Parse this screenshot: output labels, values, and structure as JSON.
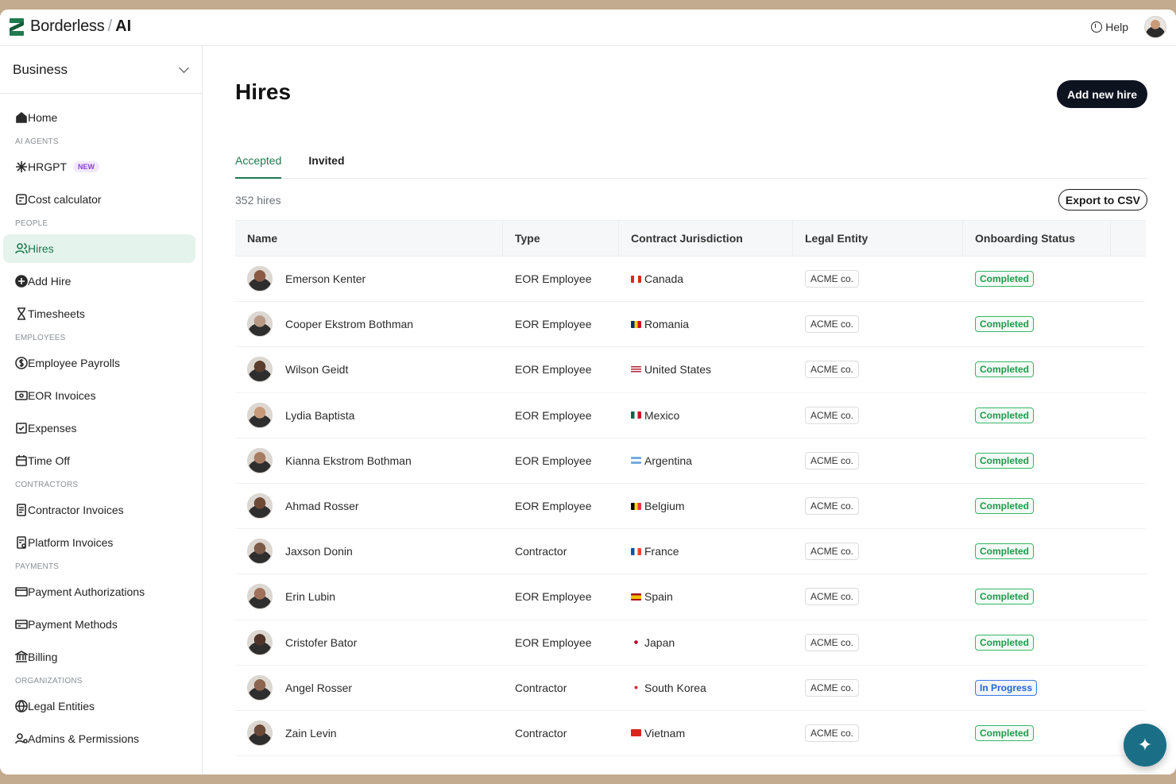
{
  "brand": {
    "name": "Borderless",
    "separator": "/",
    "suffix": "AI"
  },
  "header": {
    "help_label": "Help"
  },
  "sidebar": {
    "workspace": "Business",
    "home": "Home",
    "sections": {
      "ai_agents": "AI AGENTS",
      "people": "PEOPLE",
      "employees": "EMPLOYEES",
      "contractors": "CONTRACTORS",
      "payments": "PAYMENTS",
      "organizations": "ORGANIZATIONS"
    },
    "items": {
      "hrgpt": "HRGPT",
      "hrgpt_badge": "NEW",
      "cost_calculator": "Cost calculator",
      "hires": "Hires",
      "add_hire": "Add Hire",
      "timesheets": "Timesheets",
      "employee_payrolls": "Employee Payrolls",
      "eor_invoices": "EOR Invoices",
      "expenses": "Expenses",
      "time_off": "Time Off",
      "contractor_invoices": "Contractor Invoices",
      "platform_invoices": "Platform Invoices",
      "payment_authorizations": "Payment Authorizations",
      "payment_methods": "Payment Methods",
      "billing": "Billing",
      "legal_entities": "Legal Entities",
      "admins_permissions": "Admins & Permissions"
    }
  },
  "main": {
    "title": "Hires",
    "add_button": "Add new hire",
    "tabs": [
      "Accepted",
      "Invited"
    ],
    "count": "352 hires",
    "export_button": "Export to CSV",
    "columns": [
      "Name",
      "Type",
      "Contract Jurisdiction",
      "Legal Entity",
      "Onboarding Status"
    ],
    "rows": [
      {
        "name": "Emerson Kenter",
        "type": "EOR Employee",
        "country": "Canada",
        "entity": "ACME co.",
        "status": "Completed"
      },
      {
        "name": "Cooper Ekstrom Bothman",
        "type": "EOR Employee",
        "country": "Romania",
        "entity": "ACME co.",
        "status": "Completed"
      },
      {
        "name": "Wilson Geidt",
        "type": "EOR Employee",
        "country": "United States",
        "entity": "ACME co.",
        "status": "Completed"
      },
      {
        "name": "Lydia Baptista",
        "type": "EOR Employee",
        "country": "Mexico",
        "entity": "ACME co.",
        "status": "Completed"
      },
      {
        "name": "Kianna Ekstrom Bothman",
        "type": "EOR Employee",
        "country": "Argentina",
        "entity": "ACME co.",
        "status": "Completed"
      },
      {
        "name": "Ahmad Rosser",
        "type": "EOR Employee",
        "country": "Belgium",
        "entity": "ACME co.",
        "status": "Completed"
      },
      {
        "name": "Jaxson Donin",
        "type": "Contractor",
        "country": "France",
        "entity": "ACME co.",
        "status": "Completed"
      },
      {
        "name": "Erin Lubin",
        "type": "EOR Employee",
        "country": "Spain",
        "entity": "ACME co.",
        "status": "Completed"
      },
      {
        "name": "Cristofer Bator",
        "type": "EOR Employee",
        "country": "Japan",
        "entity": "ACME co.",
        "status": "Completed"
      },
      {
        "name": "Angel Rosser",
        "type": "Contractor",
        "country": "South Korea",
        "entity": "ACME co.",
        "status": "In Progress"
      },
      {
        "name": "Zain Levin",
        "type": "Contractor",
        "country": "Vietnam",
        "entity": "ACME co.",
        "status": "Completed"
      }
    ]
  },
  "colors": {
    "accent": "#1f7a4f",
    "primary_button": "#0e1320",
    "status_completed": "#39b567",
    "status_in_progress": "#3b78e7",
    "fab": "#1a6f86"
  },
  "icons": {
    "fab": "sparkle-icon"
  }
}
